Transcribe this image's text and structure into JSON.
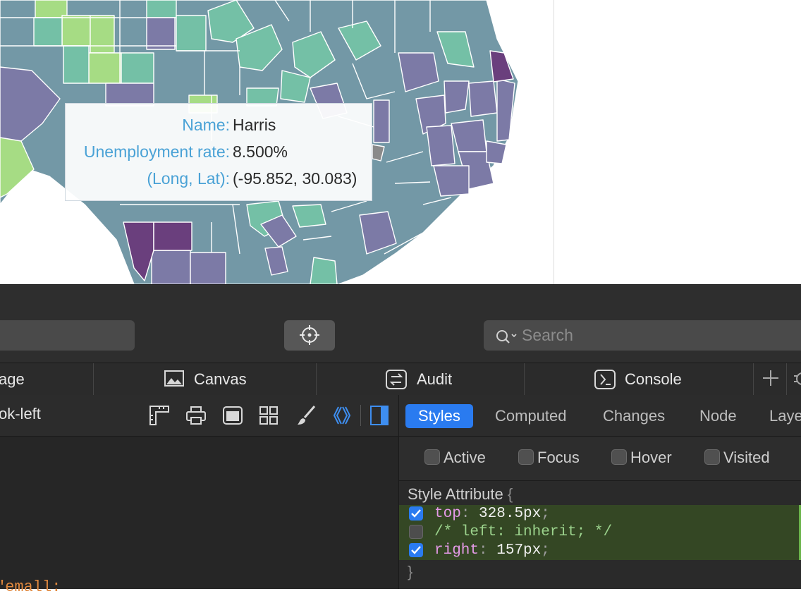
{
  "tooltip": {
    "rows": [
      {
        "key": "Name:",
        "value": "Harris"
      },
      {
        "key": "Unemployment rate:",
        "value": "8.500%"
      },
      {
        "key": "(Long, Lat):",
        "value": "(-95.852, 30.083)"
      }
    ]
  },
  "devtools": {
    "search_placeholder": "Search",
    "tabs": [
      {
        "label": "age",
        "icon": "page-icon"
      },
      {
        "label": "Canvas",
        "icon": "image-icon"
      },
      {
        "label": "Audit",
        "icon": "audit-icon"
      },
      {
        "label": "Console",
        "icon": "console-icon"
      }
    ],
    "breadcrumb": "ok-left",
    "bottom_code": "\"emall:",
    "sidebar_tabs": [
      "Styles",
      "Computed",
      "Changes",
      "Node",
      "Layers"
    ],
    "active_sidebar_tab": "Styles",
    "pseudo_classes": [
      "Active",
      "Focus",
      "Hover",
      "Visited"
    ],
    "style_attribute_title": "Style Attribute",
    "open_brace": "{",
    "close_brace": "}",
    "declarations": [
      {
        "checked": true,
        "property": "top",
        "value": "328.5px"
      },
      {
        "checked": false,
        "comment": "/* left: inherit; */"
      },
      {
        "checked": true,
        "property": "right",
        "value": "157px"
      }
    ]
  },
  "colors": {
    "tooltip_key": "#4aa2d6",
    "active_tab": "#2a7bf0",
    "map_low": "#a6dc84",
    "map_mid": "#6fa3aa",
    "map_high": "#6a3f7d"
  }
}
